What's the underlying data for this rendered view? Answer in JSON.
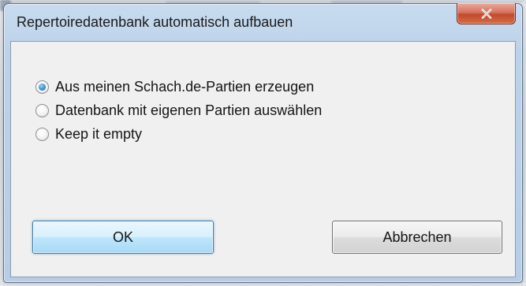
{
  "dialog": {
    "title": "Repertoiredatenbank automatisch aufbauen",
    "close_icon": "close-icon"
  },
  "options": [
    {
      "label": "Aus meinen Schach.de-Partien erzeugen",
      "selected": true
    },
    {
      "label": "Datenbank mit eigenen Partien auswählen",
      "selected": false
    },
    {
      "label": "Keep it empty",
      "selected": false
    }
  ],
  "buttons": {
    "ok_label": "OK",
    "cancel_label": "Abbrechen"
  },
  "colors": {
    "window_frame": "#bcd2ea",
    "close_button": "#c14a2c",
    "default_button_border": "#3c7fb1",
    "client_background": "#f0f0f0"
  }
}
